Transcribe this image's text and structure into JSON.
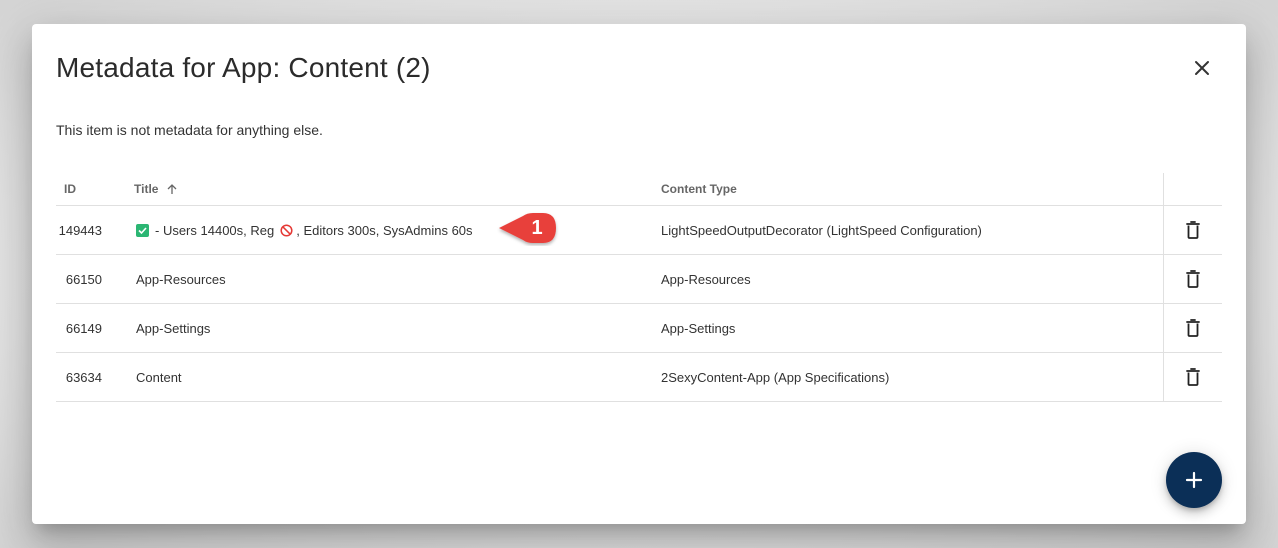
{
  "dialog": {
    "title": "Metadata for App: Content (2)",
    "subtitle": "This item is not metadata for anything else."
  },
  "table": {
    "headers": {
      "id": "ID",
      "title": "Title",
      "content_type": "Content Type"
    },
    "rows": [
      {
        "id": "149443",
        "title_part1": "- Users 14400s, Reg",
        "title_part2": ", Editors 300s, SysAdmins 60s",
        "content_type": "LightSpeedOutputDecorator (LightSpeed Configuration)"
      },
      {
        "id": "66150",
        "title": "App-Resources",
        "content_type": "App-Resources"
      },
      {
        "id": "66149",
        "title": "App-Settings",
        "content_type": "App-Settings"
      },
      {
        "id": "63634",
        "title": "Content",
        "content_type": "2SexyContent-App (App Specifications)"
      }
    ]
  },
  "callout": {
    "number": "1",
    "color": "#e8403b"
  },
  "colors": {
    "fab": "#0b2f57",
    "check": "#2bb673",
    "ban": "#e53935"
  },
  "icons": {
    "close": "close-icon",
    "sort": "arrow-up-icon",
    "delete": "trash-icon",
    "add": "plus-icon"
  }
}
